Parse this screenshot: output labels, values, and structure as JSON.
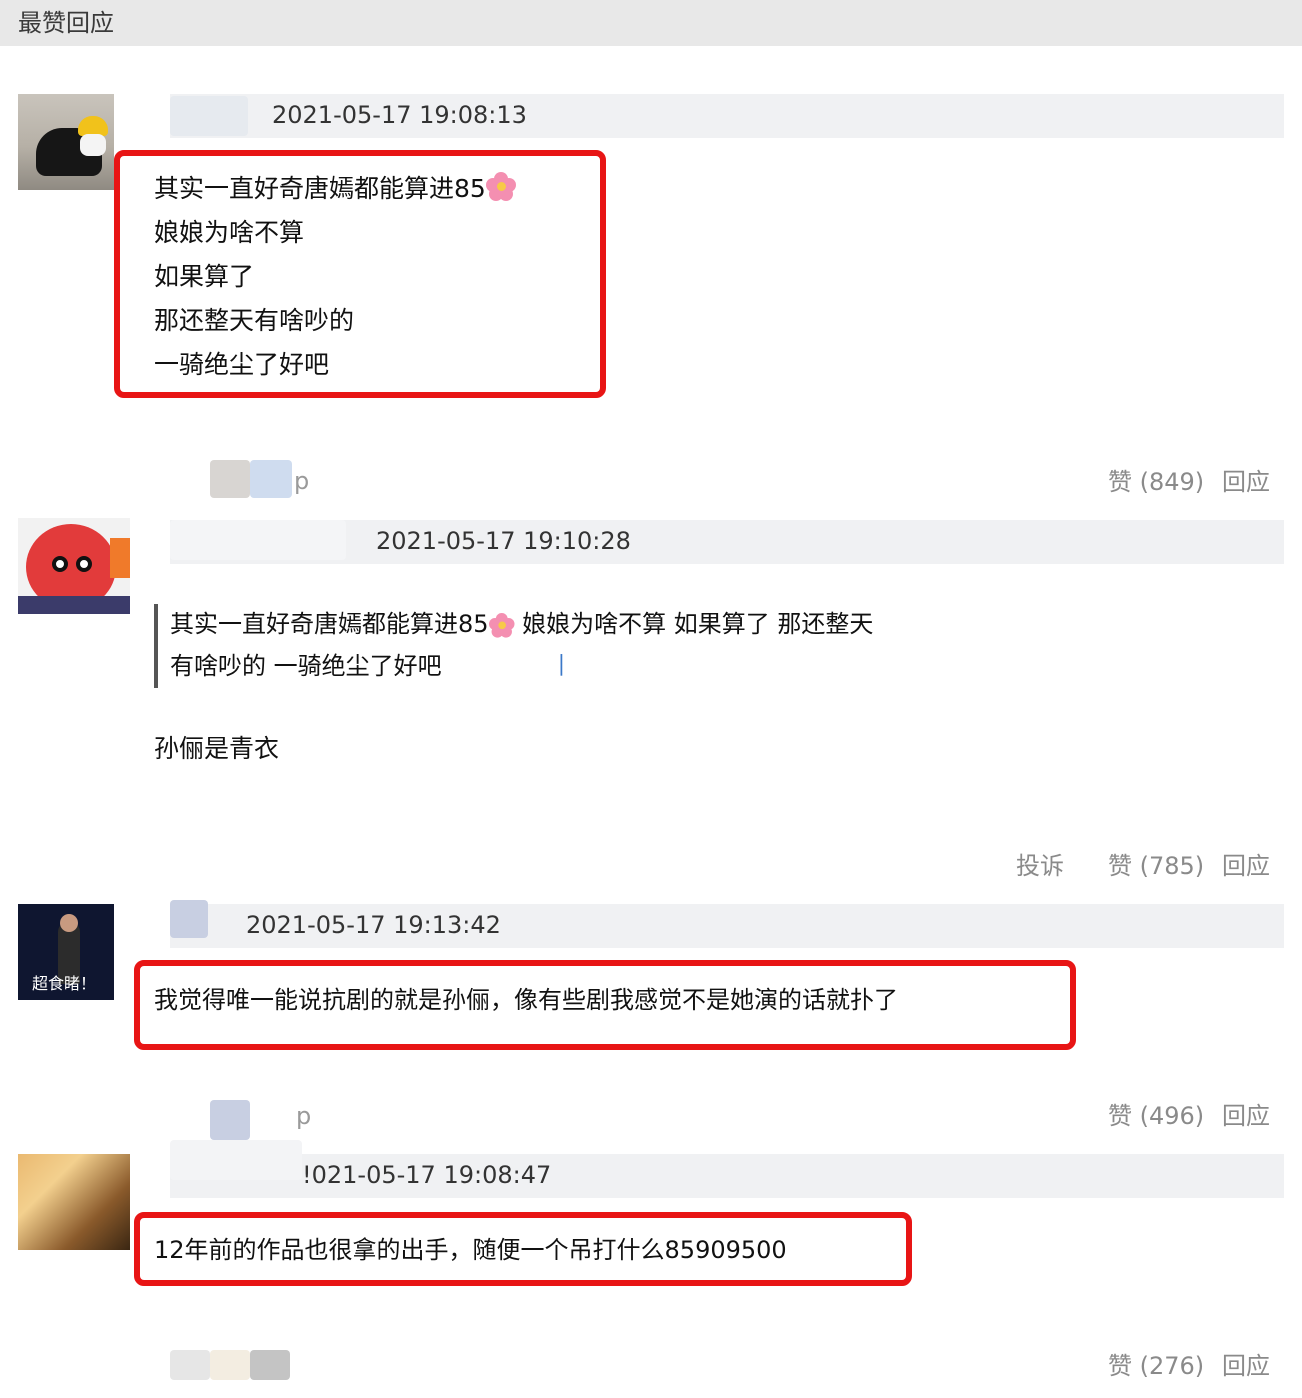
{
  "header": {
    "title": "最赞回应"
  },
  "comments": [
    {
      "timestamp": "2021-05-17 19:08:13",
      "lines": [
        "其实一直好奇唐嫣都能算进85",
        "娘娘为啥不算",
        "如果算了",
        "那还整天有啥吵的",
        "一骑绝尘了好吧"
      ],
      "username_suffix": "p",
      "like_label": "赞 (849)",
      "reply_label": "回应"
    },
    {
      "timestamp": "2021-05-17 19:10:28",
      "quote_line1_a": "其实一直好奇唐嫣都能算进85",
      "quote_line1_b": " 娘娘为啥不算 如果算了 那还整天",
      "quote_line2": "有啥吵的 一骑绝尘了好吧",
      "text": "孙俪是青衣",
      "avatar_caption": "",
      "report_label": "投诉",
      "like_label": "赞 (785)",
      "reply_label": "回应"
    },
    {
      "timestamp": "2021-05-17 19:13:42",
      "text": "我觉得唯一能说抗剧的就是孙俪，像有些剧我感觉不是她演的话就扑了",
      "avatar_caption": "超食睹！",
      "username_suffix": "p",
      "like_label": "赞 (496)",
      "reply_label": "回应"
    },
    {
      "timestamp": "2021-05-17 19:08:47",
      "timestamp_shown": "!021-05-17 19:08:47",
      "text": "12年前的作品也很拿的出手，随便一个吊打什么85909500",
      "like_label": "赞 (276)",
      "reply_label": "回应"
    }
  ],
  "icons": {
    "emoji": "cherry-blossom-emoji"
  },
  "colors": {
    "highlight_border": "#e81515",
    "meta_bg": "#f0f1f3",
    "action_text": "#8a8a8a"
  }
}
